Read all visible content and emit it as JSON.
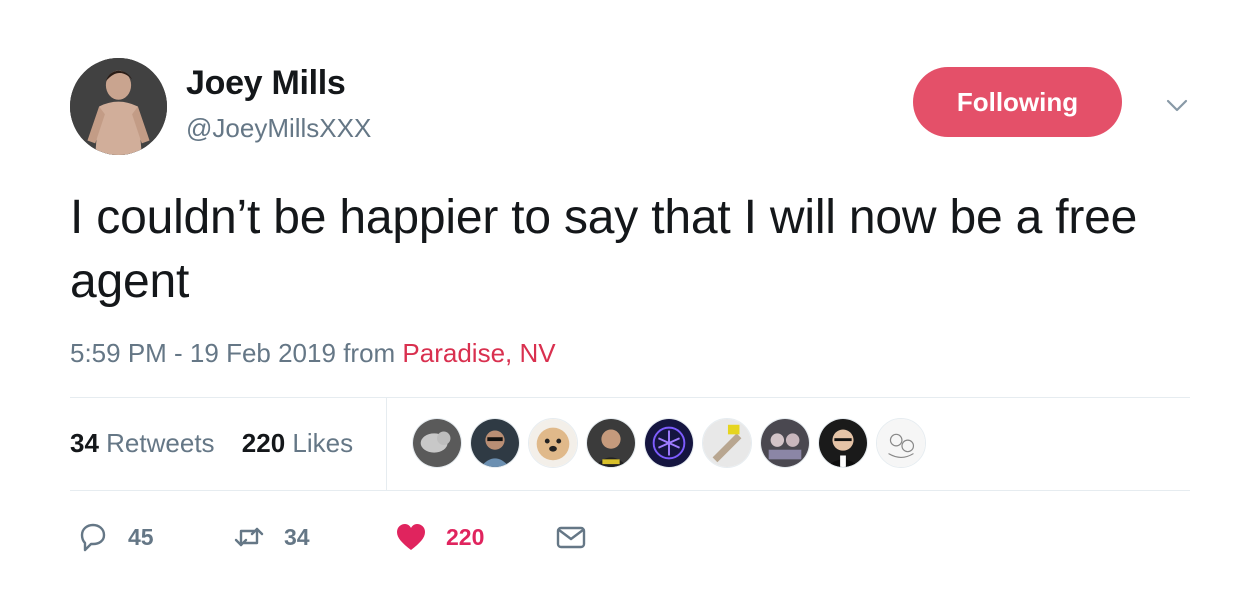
{
  "user": {
    "display_name": "Joey Mills",
    "handle": "@JoeyMillsXXX"
  },
  "follow_button": {
    "label": "Following"
  },
  "tweet": {
    "text": "I couldn’t be happier to say that I will now be a free agent",
    "time": "5:59 PM - 19 Feb 2019",
    "from_label": "from",
    "location": "Paradise, NV"
  },
  "stats": {
    "retweets_count": "34",
    "retweets_label": "Retweets",
    "likes_count": "220",
    "likes_label": "Likes"
  },
  "actions": {
    "reply_count": "45",
    "retweet_count": "34",
    "like_count": "220"
  },
  "colors": {
    "accent": "#e45069",
    "like": "#e0245e",
    "muted": "#657786"
  },
  "icons": [
    "reply-icon",
    "retweet-icon",
    "heart-icon",
    "envelope-icon",
    "chevron-down-icon"
  ]
}
